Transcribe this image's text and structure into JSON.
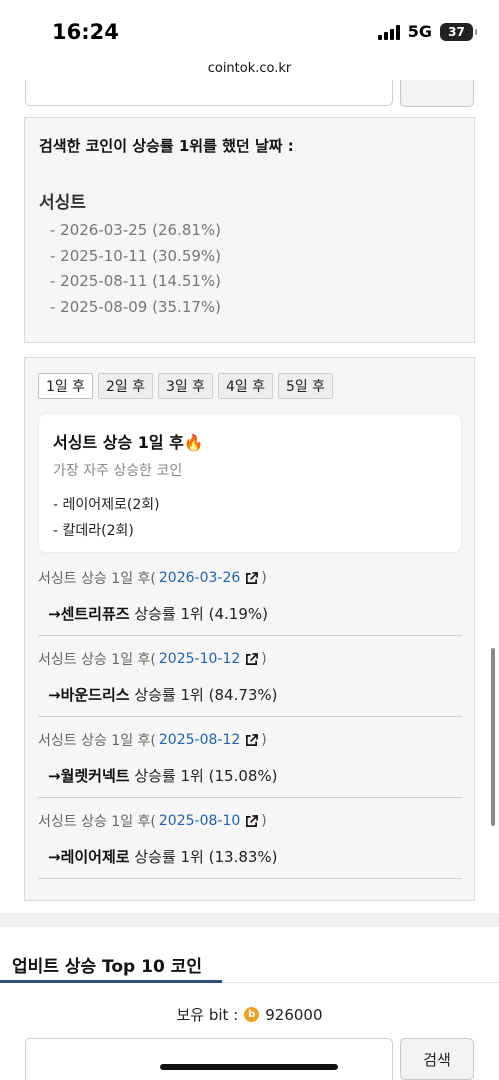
{
  "status_bar": {
    "time": "16:24",
    "network": "5G",
    "battery": "37"
  },
  "browser": {
    "url": "cointok.co.kr"
  },
  "search_top": {
    "value": "",
    "button_label": ""
  },
  "rank_dates": {
    "heading": "검색한 코인이 상승률 1위를 했던 날짜 :",
    "coin_name": "서싱트",
    "dates": [
      "- 2026-03-25 (26.81%)",
      "- 2025-10-11 (30.59%)",
      "- 2025-08-11 (14.51%)",
      "- 2025-08-09 (35.17%)"
    ]
  },
  "after_days": {
    "tabs": [
      {
        "label": "1일 후",
        "active": true
      },
      {
        "label": "2일 후",
        "active": false
      },
      {
        "label": "3일 후",
        "active": false
      },
      {
        "label": "4일 후",
        "active": false
      },
      {
        "label": "5일 후",
        "active": false
      }
    ],
    "summary": {
      "title": "서싱트 상승 1일 후🔥",
      "subtitle": "가장 자주 상승한 코인",
      "items": [
        "- 레이어제로(2회)",
        "- 칼데라(2회)"
      ]
    },
    "rows": [
      {
        "prefix": "서싱트 상승 1일 후(",
        "date": "2026-03-26",
        "suffix": ")",
        "arrow_coin": "→센트리퓨즈",
        "result": " 상승률 1위 (4.19%)"
      },
      {
        "prefix": "서싱트 상승 1일 후(",
        "date": "2025-10-12",
        "suffix": ")",
        "arrow_coin": "→바운드리스",
        "result": " 상승률 1위 (84.73%)"
      },
      {
        "prefix": "서싱트 상승 1일 후(",
        "date": "2025-08-12",
        "suffix": ")",
        "arrow_coin": "→월렛커넥트",
        "result": " 상승률 1위 (15.08%)"
      },
      {
        "prefix": "서싱트 상승 1일 후(",
        "date": "2025-08-10",
        "suffix": ")",
        "arrow_coin": "→레이어제로",
        "result": " 상승률 1위 (13.83%)"
      }
    ]
  },
  "top10": {
    "title": "업비트 상승 Top 10 코인",
    "bit_label": "보유 bit :",
    "bit_icon": "b",
    "bit_value": "926000",
    "search_placeholder": "",
    "search_button": "검색"
  },
  "colors": {
    "link": "#1e63b5",
    "accent": "#2f4b7c",
    "coin": "#f0a020"
  }
}
